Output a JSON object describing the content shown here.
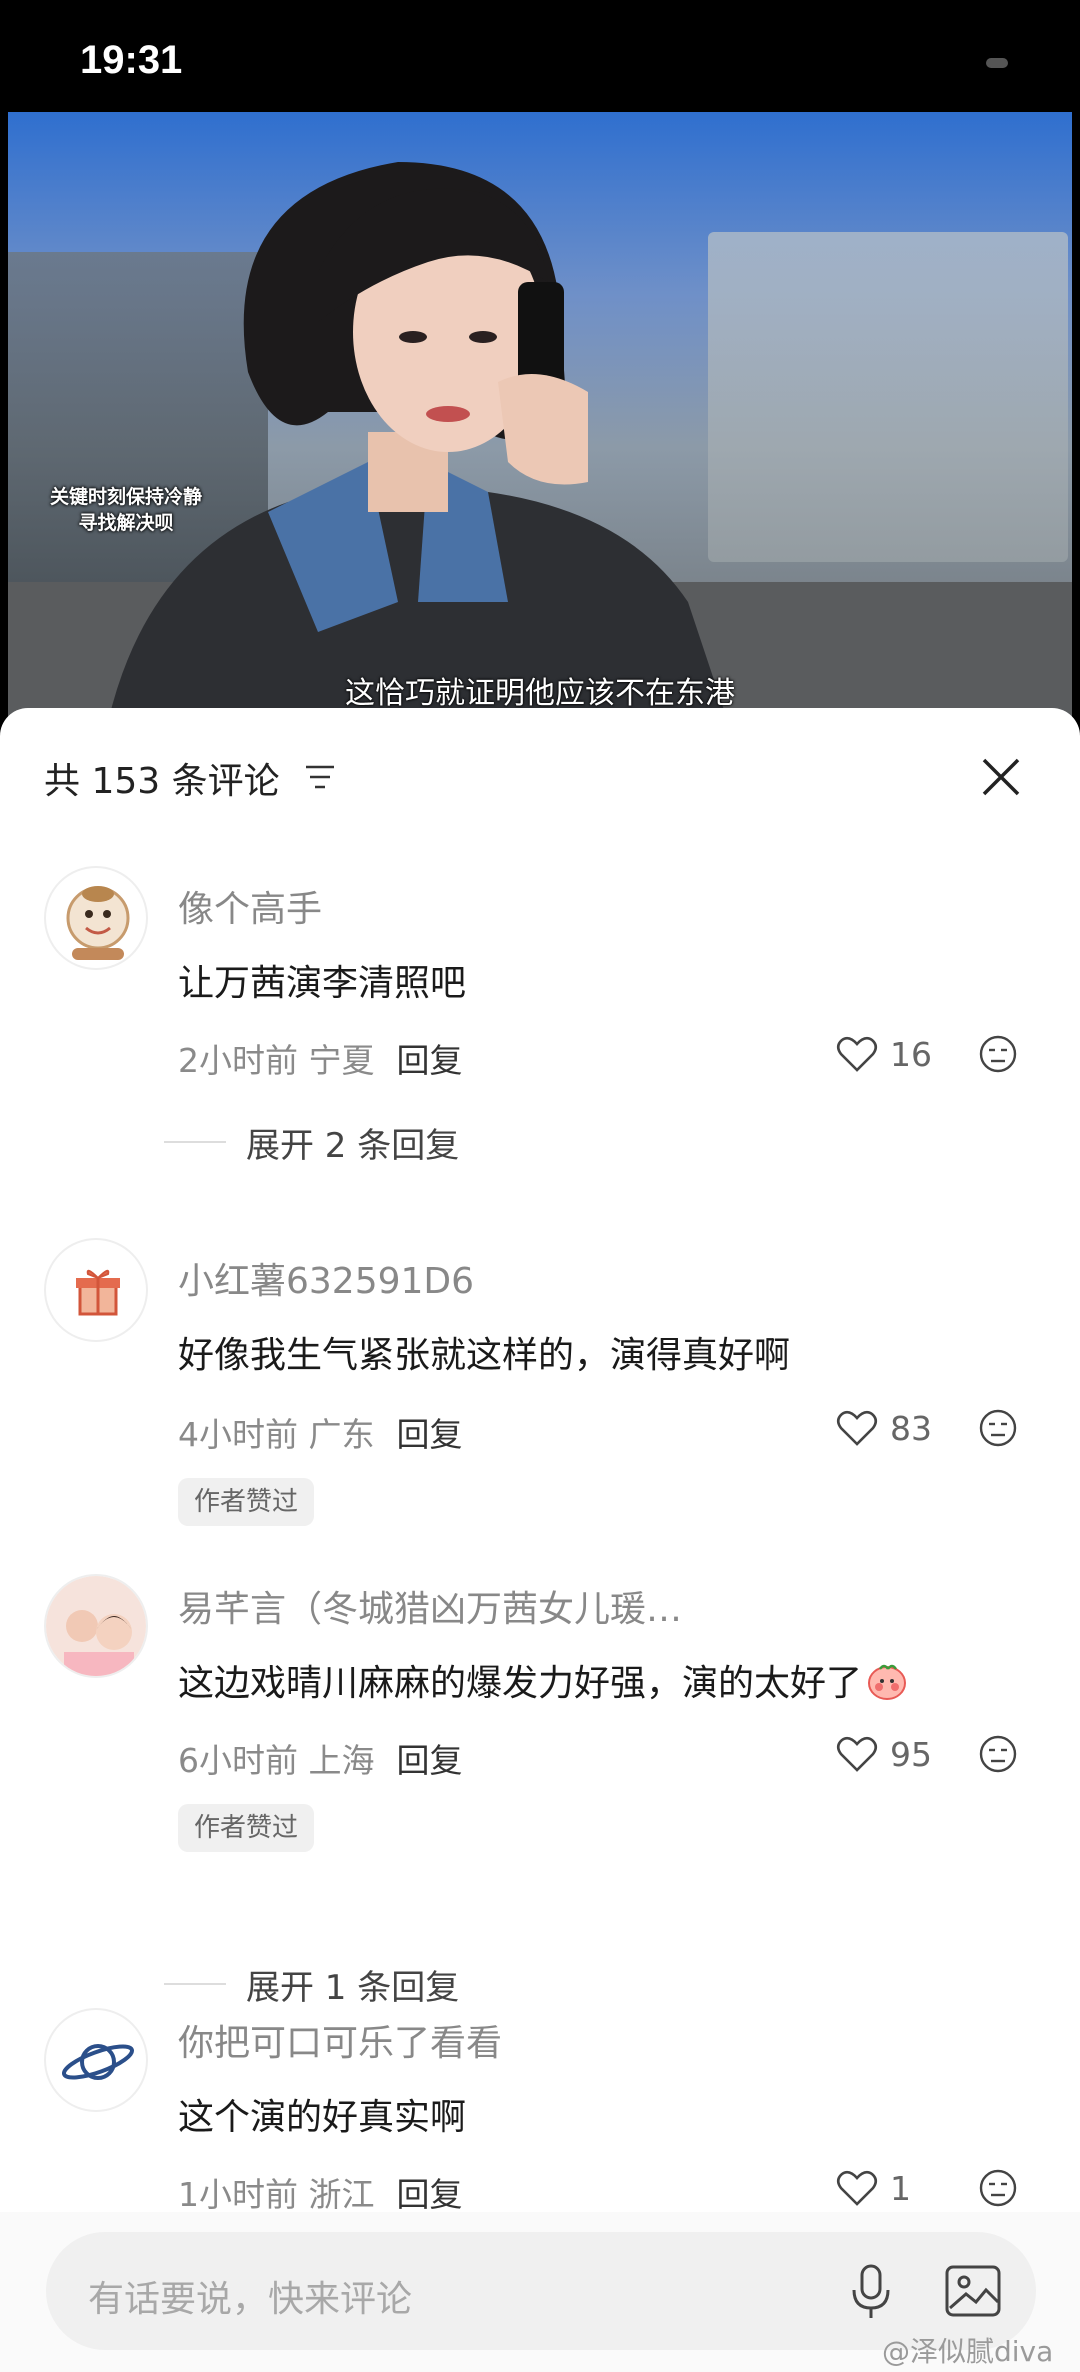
{
  "status_bar": {
    "time": "19:31"
  },
  "video": {
    "caption_left_line1": "关键时刻保持冷静",
    "caption_left_line2": "寻找解决呗",
    "subtitle": "这恰巧就证明他应该不在东港"
  },
  "comments_header": {
    "count_text": "共 153 条评论"
  },
  "comments": [
    {
      "username": "像个高手",
      "text": "让万茜演李清照吧",
      "time_location": "2小时前 宁夏",
      "reply_label": "回复",
      "likes": "16",
      "expand_text": "展开 2 条回复"
    },
    {
      "username": "小红薯632591D6",
      "text": "好像我生气紧张就这样的，演得真好啊",
      "time_location": "4小时前 广东",
      "reply_label": "回复",
      "likes": "83",
      "badge": "作者赞过"
    },
    {
      "username": "易芊言（冬城猎凶万茜女儿瑗…",
      "text": "这边戏晴川麻麻的爆发力好强，演的太好了",
      "time_location": "6小时前 上海",
      "reply_label": "回复",
      "likes": "95",
      "badge": "作者赞过",
      "expand_text": "展开 1 条回复"
    },
    {
      "username": "你把可口可乐了看看",
      "text": "这个演的好真实啊",
      "time_location": "1小时前 浙江",
      "reply_label": "回复",
      "likes": "1"
    }
  ],
  "input": {
    "placeholder": "有话要说，快来评论"
  },
  "watermark": "@泽似腻diva",
  "colors": {
    "sheet_bg": "#ffffff",
    "text_primary": "#1a1a1a",
    "text_secondary": "#888888",
    "badge_bg": "#f0f0f0"
  },
  "icons": [
    "filter-icon",
    "close-icon",
    "heart-icon",
    "dislike-face-icon",
    "microphone-icon",
    "image-icon",
    "gift-icon",
    "planet-icon"
  ]
}
